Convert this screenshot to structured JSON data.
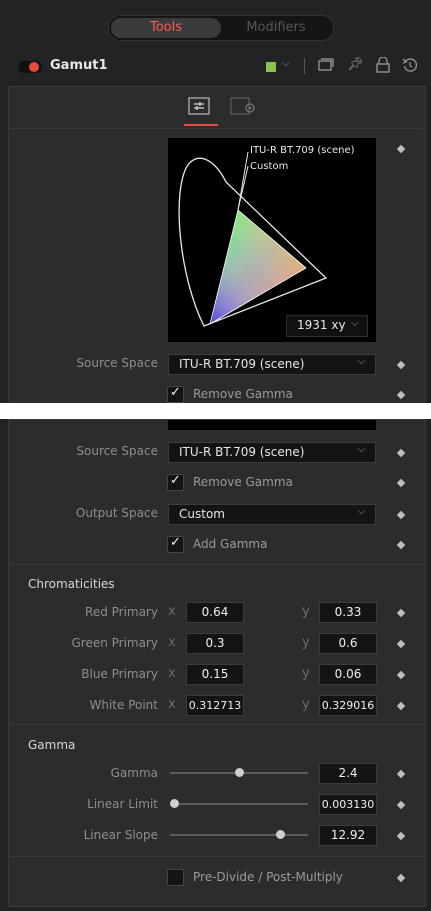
{
  "tabs": {
    "tools": "Tools",
    "modifiers": "Modifiers"
  },
  "node": {
    "name": "Gamut1",
    "color": "#8bc34a"
  },
  "chart": {
    "label1": "ITU-R BT.709 (scene)",
    "label2": "Custom",
    "mode": "1931 xy"
  },
  "top": {
    "source_label": "Source Space",
    "source_value": "ITU-R BT.709 (scene)",
    "remove_gamma": "Remove Gamma"
  },
  "bottom": {
    "source_label": "Source Space",
    "source_value": "ITU-R BT.709 (scene)",
    "remove_gamma": "Remove Gamma",
    "output_label": "Output Space",
    "output_value": "Custom",
    "add_gamma": "Add Gamma"
  },
  "chromaticities": {
    "title": "Chromaticities",
    "x_label": "x",
    "y_label": "y",
    "rows": [
      {
        "label": "Red Primary",
        "x": "0.64",
        "y": "0.33"
      },
      {
        "label": "Green Primary",
        "x": "0.3",
        "y": "0.6"
      },
      {
        "label": "Blue Primary",
        "x": "0.15",
        "y": "0.06"
      },
      {
        "label": "White Point",
        "x": "0.312713",
        "y": "0.329016"
      }
    ]
  },
  "gamma": {
    "title": "Gamma",
    "rows": [
      {
        "label": "Gamma",
        "value": "2.4"
      },
      {
        "label": "Linear Limit",
        "value": "0.003130"
      },
      {
        "label": "Linear Slope",
        "value": "12.92"
      }
    ],
    "slider_fraction": [
      0.5,
      0.03,
      0.8
    ]
  },
  "predivide": "Pre-Divide / Post-Multiply",
  "colors": {
    "accent_red": "#e64a3b",
    "active_tab_text": "#ff5a4a"
  }
}
